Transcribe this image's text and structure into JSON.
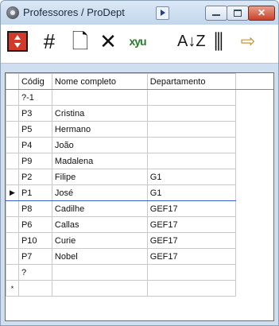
{
  "window": {
    "title": "Professores / ProDept",
    "close_label": "✕"
  },
  "toolbar": {
    "buttons": [
      {
        "name": "navigate-icon",
        "glyph": ""
      },
      {
        "name": "grid-icon",
        "glyph": "#"
      },
      {
        "name": "new-record-icon",
        "glyph": "🗋"
      },
      {
        "name": "delete-icon",
        "glyph": "✕"
      },
      {
        "name": "filter-icon",
        "glyph": "xyu"
      },
      {
        "name": "sort-icon",
        "glyph": "A↓Z"
      },
      {
        "name": "columns-icon",
        "glyph": "⫼"
      },
      {
        "name": "export-icon",
        "glyph": "⇨"
      }
    ]
  },
  "table": {
    "columns": [
      "Códig",
      "Nome completo",
      "Departamento"
    ],
    "rows": [
      {
        "codigo": "?-1",
        "nome": "",
        "dept": ""
      },
      {
        "codigo": "P3",
        "nome": "Cristina",
        "dept": ""
      },
      {
        "codigo": "P5",
        "nome": "Hermano",
        "dept": ""
      },
      {
        "codigo": "P4",
        "nome": "João",
        "dept": ""
      },
      {
        "codigo": "P9",
        "nome": "Madalena",
        "dept": ""
      },
      {
        "codigo": "P2",
        "nome": "Filipe",
        "dept": "G1"
      },
      {
        "codigo": "P1",
        "nome": "José",
        "dept": "G1",
        "current": true
      },
      {
        "codigo": "P8",
        "nome": "Cadilhe",
        "dept": "GEF17"
      },
      {
        "codigo": "P6",
        "nome": "Callas",
        "dept": "GEF17"
      },
      {
        "codigo": "P10",
        "nome": "Curie",
        "dept": "GEF17"
      },
      {
        "codigo": "P7",
        "nome": "Nobel",
        "dept": "GEF17"
      },
      {
        "codigo": "?",
        "nome": "",
        "dept": ""
      }
    ],
    "current_marker": "▶",
    "new_row_marker": "*"
  }
}
